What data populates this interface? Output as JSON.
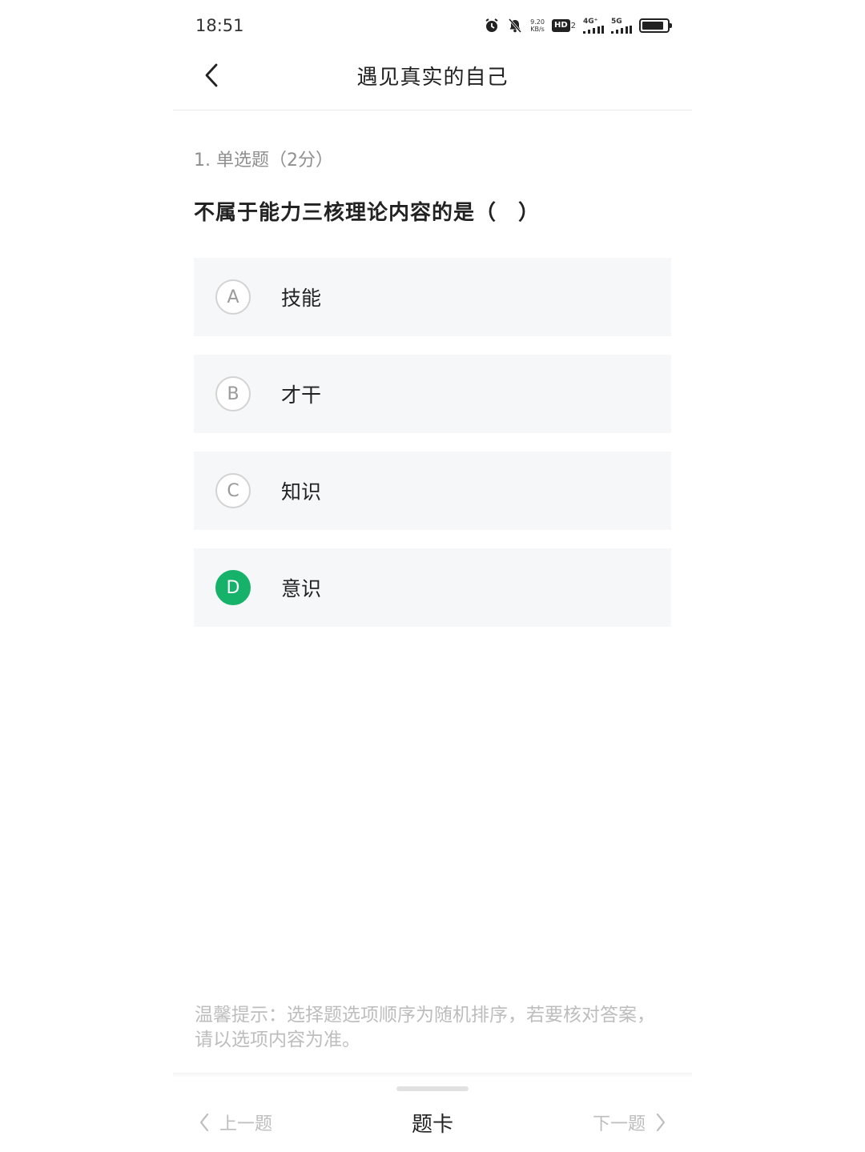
{
  "status_bar": {
    "time": "18:51",
    "net_speed_value": "9.20",
    "net_speed_unit": "KB/s",
    "hd_label": "HD",
    "hd_sub": "2",
    "sig1_label": "4G⁺",
    "sig2_label": "5G",
    "battery_level": 0.85,
    "icons": [
      "alarm-icon",
      "mute-bell-icon",
      "signal-icon",
      "battery-icon"
    ]
  },
  "nav": {
    "back_icon": "chevron-left-icon",
    "title": "遇见真实的自己"
  },
  "question": {
    "meta": "1. 单选题（2分）",
    "text": "不属于能力三核理论内容的是（　）",
    "options": [
      {
        "letter": "A",
        "text": "技能",
        "selected": false
      },
      {
        "letter": "B",
        "text": "才干",
        "selected": false
      },
      {
        "letter": "C",
        "text": "知识",
        "selected": false
      },
      {
        "letter": "D",
        "text": "意识",
        "selected": true
      }
    ]
  },
  "tip": "温馨提示：选择题选项顺序为随机排序，若要核对答案，请以选项内容为准。",
  "bottom_bar": {
    "prev_label": "上一题",
    "card_label": "题卡",
    "next_label": "下一题"
  },
  "colors": {
    "accent": "#17b26a",
    "option_bg": "#f5f7f9",
    "muted_text": "#bdbdbd"
  }
}
